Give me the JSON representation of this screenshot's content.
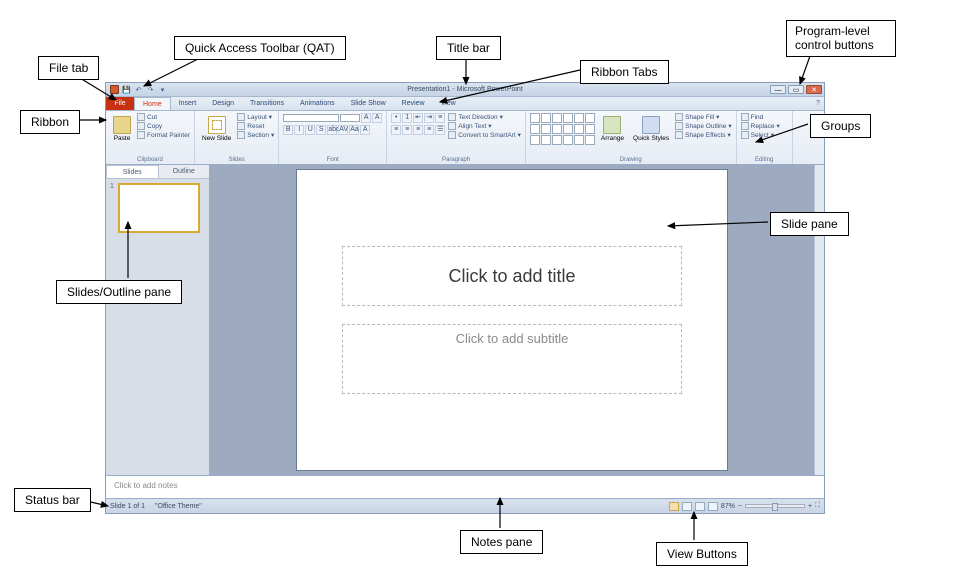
{
  "callouts": {
    "file_tab": "File tab",
    "qat": "Quick Access Toolbar (QAT)",
    "title_bar": "Title bar",
    "program_controls": "Program-level control buttons",
    "ribbon_tabs": "Ribbon Tabs",
    "ribbon": "Ribbon",
    "groups": "Groups",
    "slides_outline": "Slides/Outline pane",
    "slide_pane": "Slide pane",
    "status_bar": "Status bar",
    "notes_pane": "Notes pane",
    "view_buttons": "View Buttons"
  },
  "titlebar": {
    "title": "Presentation1 - Microsoft PowerPoint"
  },
  "win": {
    "min": "—",
    "max": "▭",
    "close": "✕"
  },
  "tabs": {
    "file": "File",
    "items": [
      "Home",
      "Insert",
      "Design",
      "Transitions",
      "Animations",
      "Slide Show",
      "Review",
      "View"
    ],
    "help": "?"
  },
  "ribbon_groups": {
    "clipboard": {
      "label": "Clipboard",
      "paste": "Paste",
      "cut": "Cut",
      "copy": "Copy",
      "format_painter": "Format Painter"
    },
    "slides": {
      "label": "Slides",
      "new_slide": "New Slide",
      "layout": "Layout",
      "reset": "Reset",
      "section": "Section"
    },
    "font": {
      "label": "Font",
      "b": "B",
      "i": "I",
      "u": "U",
      "s": "S",
      "ab": "abc",
      "av": "AV",
      "aa": "Aa",
      "a": "A"
    },
    "paragraph": {
      "label": "Paragraph",
      "text_direction": "Text Direction",
      "align_text": "Align Text",
      "convert_smartart": "Convert to SmartArt"
    },
    "drawing": {
      "label": "Drawing",
      "arrange": "Arrange",
      "quick_styles": "Quick Styles",
      "shape_fill": "Shape Fill",
      "shape_outline": "Shape Outline",
      "shape_effects": "Shape Effects"
    },
    "editing": {
      "label": "Editing",
      "find": "Find",
      "replace": "Replace",
      "select": "Select"
    }
  },
  "left_pane": {
    "tab_slides": "Slides",
    "tab_outline": "Outline",
    "thumb_num": "1"
  },
  "slide": {
    "title_placeholder": "Click to add title",
    "subtitle_placeholder": "Click to add subtitle"
  },
  "notes": {
    "placeholder": "Click to add notes"
  },
  "statusbar": {
    "slide_of": "Slide 1 of 1",
    "theme": "\"Office Theme\"",
    "zoom": "87%"
  }
}
